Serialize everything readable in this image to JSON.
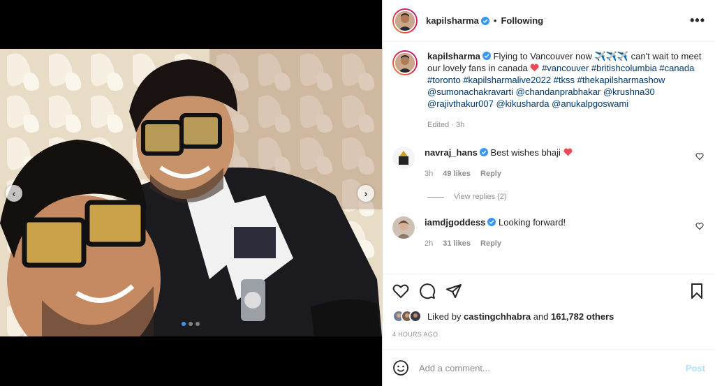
{
  "post": {
    "username": "kapilsharma",
    "follow_separator": "•",
    "follow_status": "Following",
    "more_icon": "more-options-icon",
    "caption": {
      "username": "kapilsharma",
      "text_1": "Flying to Vancouver now ",
      "text_emoji": "✈️✈️✈️",
      "text_2": " can't wait to meet our lovely fans in canada ",
      "hashtags": "#vancouver #britishcolumbia #canada #toronto #kapilsharmalive2022 #tkss #thekapilsharmashow @sumonachakravarti @chandanprabhakar @krushna30 @rajivthakur007 @kikusharda @anukalpgoswami",
      "edited": "Edited · 3h"
    },
    "comments": [
      {
        "username": "navraj_hans",
        "text": "Best wishes bhaji",
        "time": "3h",
        "likes": "49 likes",
        "reply": "Reply",
        "view_replies": "View replies (2)"
      },
      {
        "username": "iamdjgoddess",
        "text": "Looking forward!",
        "time": "2h",
        "likes": "31 likes",
        "reply": "Reply"
      }
    ],
    "liked_by_prefix": "Liked by ",
    "liked_by_user": "castingchhabra",
    "liked_by_and": " and ",
    "liked_by_count": "161,782 others",
    "timestamp": "4 HOURS AGO",
    "comment_placeholder": "Add a comment...",
    "post_button": "Post",
    "carousel": {
      "total_slides": 3,
      "active_slide": 1
    }
  },
  "colors": {
    "link": "#00376b",
    "accent": "#3897f0",
    "heart": "#ed4956",
    "muted": "#8e8e8e",
    "post_disabled": "#b2dffc"
  }
}
